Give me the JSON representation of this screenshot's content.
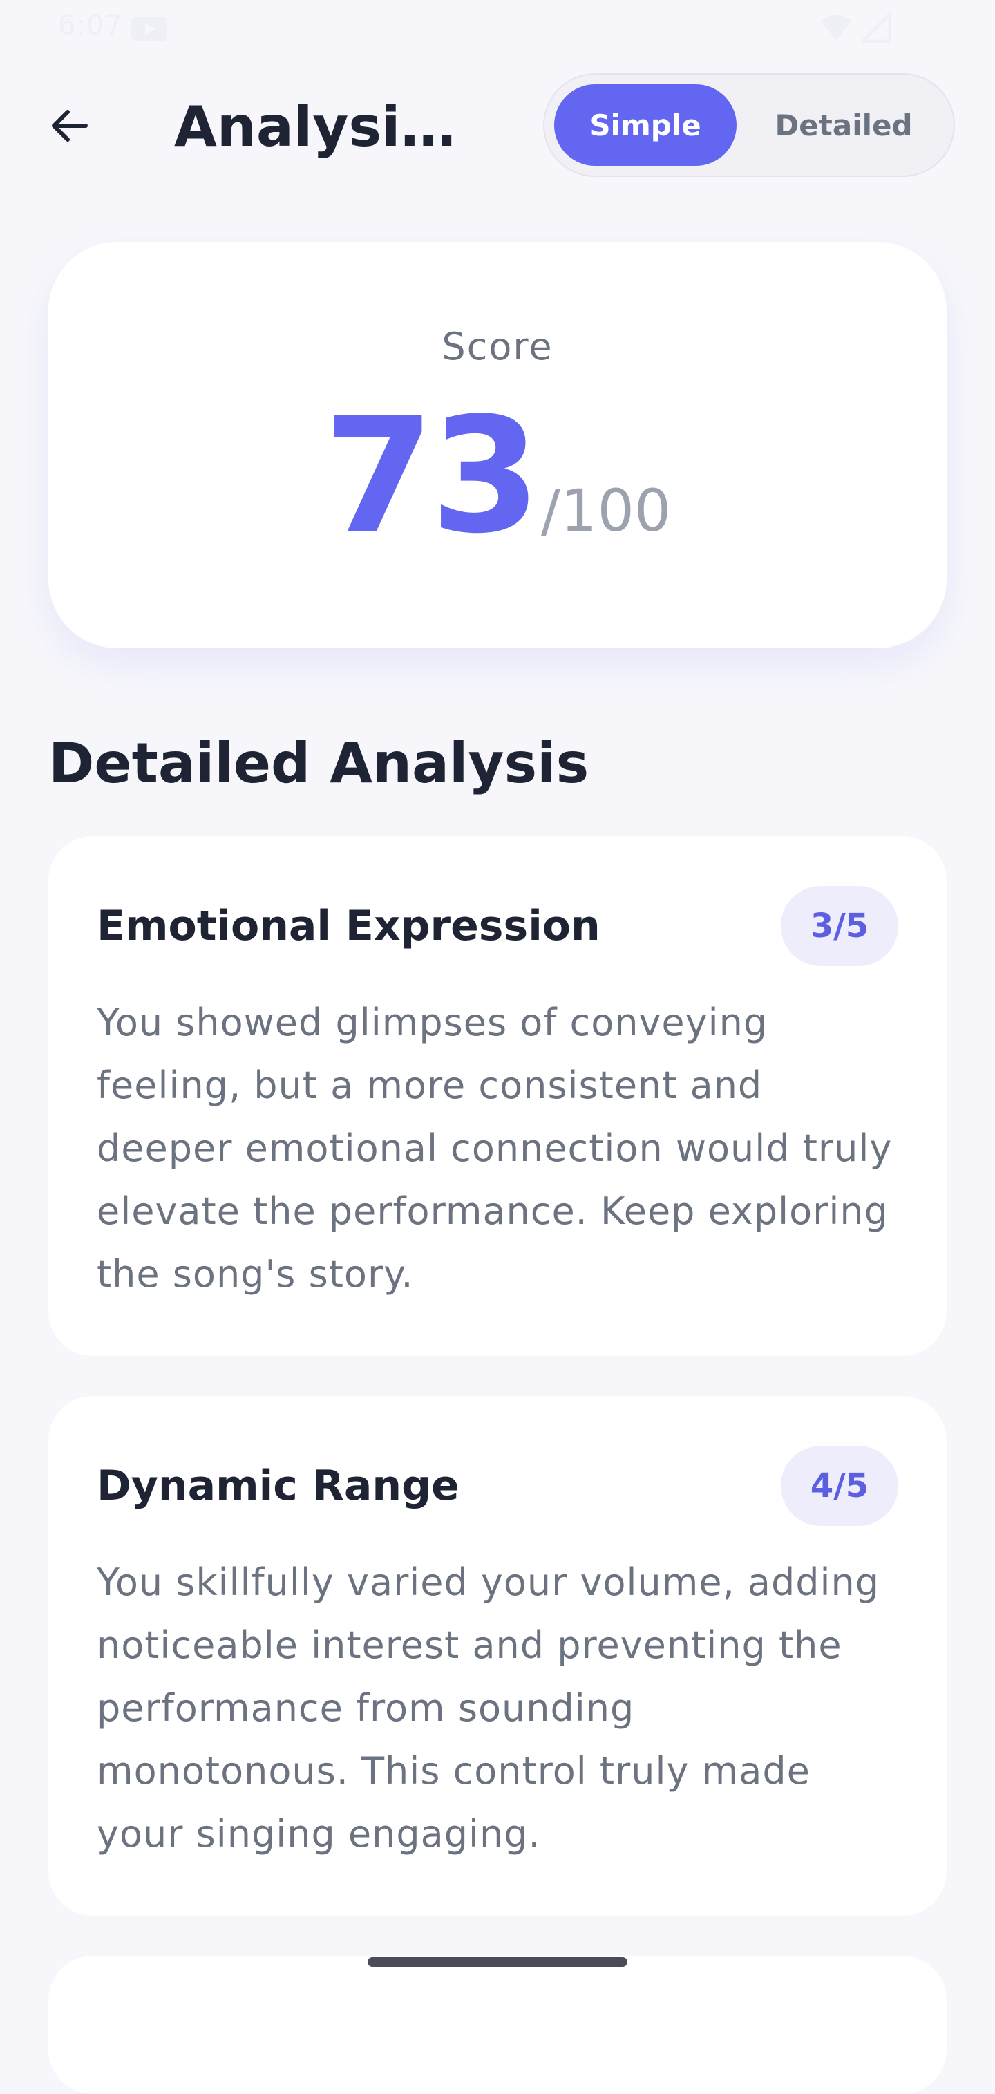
{
  "status_bar": {
    "time": "6:07",
    "icons": [
      "youtube-icon",
      "wifi-icon",
      "signal-icon"
    ]
  },
  "header": {
    "back_icon": "arrow-left-icon",
    "title": "Analysis Results",
    "toggle": {
      "options": [
        "Simple",
        "Detailed"
      ],
      "selected": "Simple"
    }
  },
  "score": {
    "label": "Score",
    "value": "73",
    "max": "/100"
  },
  "section_title": "Detailed Analysis",
  "analysis": [
    {
      "title": "Emotional Expression",
      "score": "3/5",
      "text": "You showed glimpses of conveying feeling, but a more consistent and deeper emotional connection would truly elevate the performance. Keep exploring the song's story."
    },
    {
      "title": "Dynamic Range",
      "score": "4/5",
      "text": "You skillfully varied your volume, adding noticeable interest and preventing the performance from sounding monotonous. This control truly made your singing engaging."
    }
  ],
  "colors": {
    "accent": "#6366f1",
    "background": "#f7f7fb",
    "card": "#ffffff",
    "badge_bg": "#ededfc",
    "text_primary": "#1e2433",
    "text_secondary": "#6b7280"
  }
}
